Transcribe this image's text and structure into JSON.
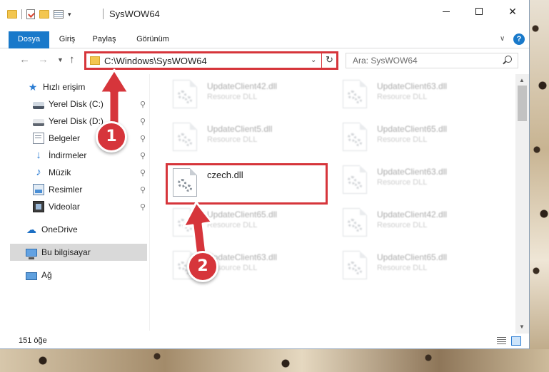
{
  "window": {
    "title": "SysWOW64"
  },
  "ribbon": {
    "tabs": [
      "Dosya",
      "Giriş",
      "Paylaş",
      "Görünüm"
    ],
    "active_tab": "Dosya",
    "help": "?"
  },
  "address": {
    "path": "C:\\Windows\\SysWOW64",
    "search_placeholder": "Ara: SysWOW64"
  },
  "sidebar": {
    "items": [
      {
        "label": "Hızlı erişim",
        "icon": "star-icon",
        "pinned": false
      },
      {
        "label": "Yerel Disk (C:)",
        "icon": "drive-icon",
        "pinned": true
      },
      {
        "label": "Yerel Disk (D:)",
        "icon": "drive-icon",
        "pinned": true
      },
      {
        "label": "Belgeler",
        "icon": "documents-icon",
        "pinned": true
      },
      {
        "label": "İndirmeler",
        "icon": "download-icon",
        "pinned": true
      },
      {
        "label": "Müzik",
        "icon": "music-icon",
        "pinned": true
      },
      {
        "label": "Resimler",
        "icon": "pictures-icon",
        "pinned": true
      },
      {
        "label": "Videolar",
        "icon": "video-icon",
        "pinned": true
      },
      {
        "label": "OneDrive",
        "icon": "cloud-icon",
        "pinned": false
      },
      {
        "label": "Bu bilgisayar",
        "icon": "computer-icon",
        "pinned": false,
        "selected": true
      },
      {
        "label": "Ağ",
        "icon": "network-icon",
        "pinned": false
      }
    ],
    "pin_glyph": "📌"
  },
  "files": [
    {
      "name": "UpdateClient42.dll",
      "desc": "Resource DLL",
      "faded": true
    },
    {
      "name": "UpdateClient63.dll",
      "desc": "Resource DLL",
      "faded": true
    },
    {
      "name": "UpdateClient5.dll",
      "desc": "Resource DLL",
      "faded": true
    },
    {
      "name": "UpdateClient65.dll",
      "desc": "Resource DLL",
      "faded": true
    },
    {
      "name": "czech.dll",
      "desc": "",
      "faded": false
    },
    {
      "name": "UpdateClient63.dll",
      "desc": "Resource DLL",
      "faded": true
    },
    {
      "name": "UpdateClient65.dll",
      "desc": "Resource DLL",
      "faded": true
    },
    {
      "name": "UpdateClient42.dll",
      "desc": "Resource DLL",
      "faded": true
    },
    {
      "name": "UpdateClient63.dll",
      "desc": "Resource DLL",
      "faded": true
    },
    {
      "name": "UpdateClient65.dll",
      "desc": "Resource DLL",
      "faded": true
    }
  ],
  "status": {
    "item_count": "151 öğe"
  },
  "callouts": [
    "1",
    "2"
  ],
  "colors": {
    "accent": "#1979ca",
    "callout": "#d6353b"
  }
}
